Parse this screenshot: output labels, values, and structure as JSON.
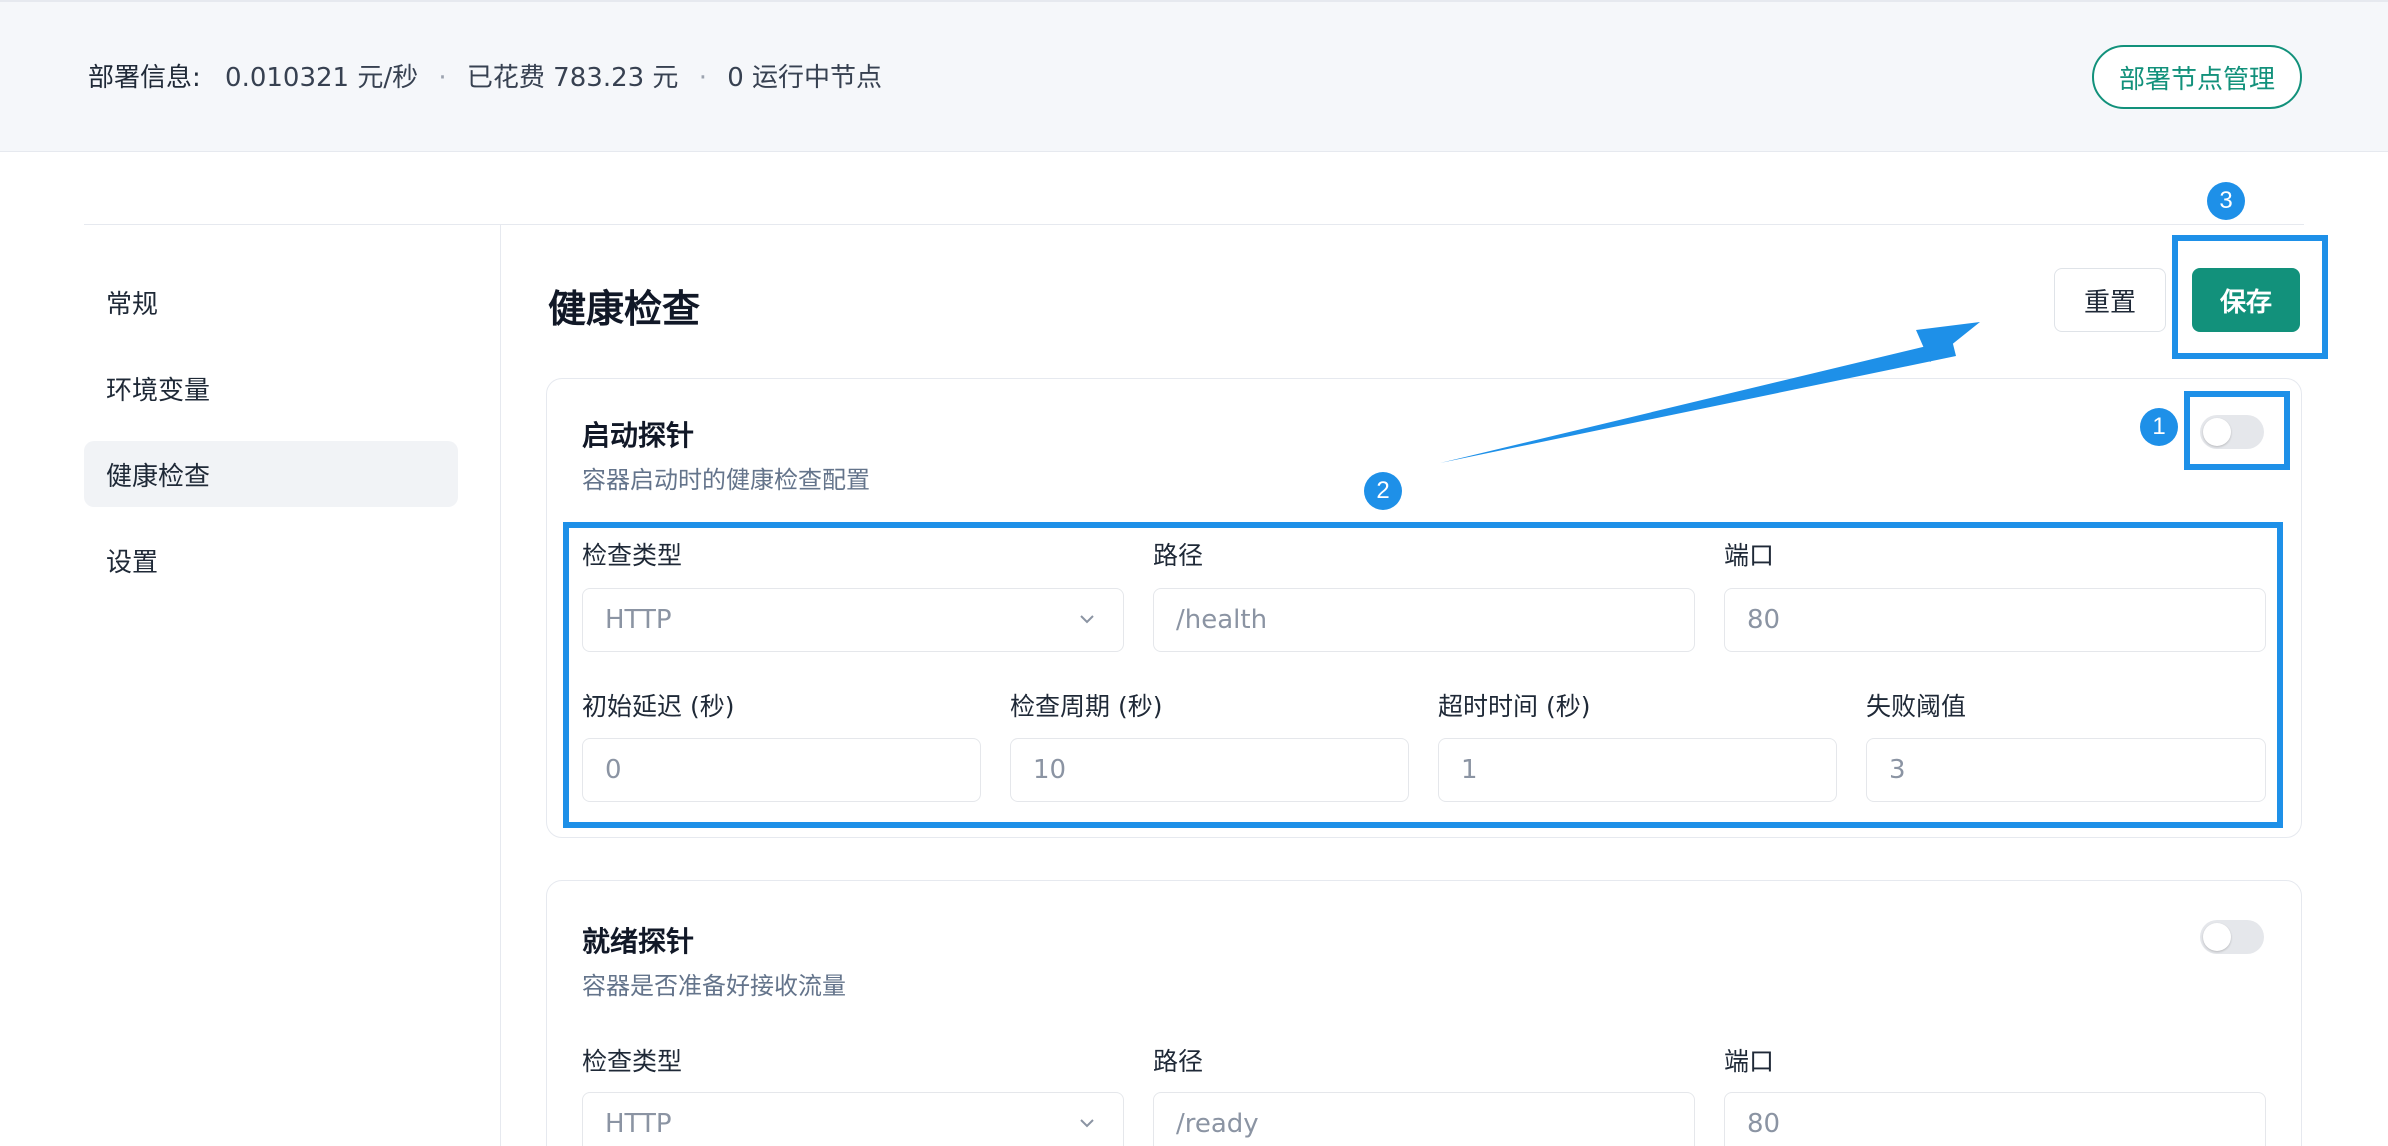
{
  "topbar": {
    "label": "部署信息:",
    "rate": "0.010321 元/秒",
    "spent": "已花费 783.23 元",
    "nodes": "0 运行中节点",
    "separator": "·",
    "manage_button": "部署节点管理"
  },
  "sidebar": {
    "items": [
      {
        "label": "常规",
        "active": false
      },
      {
        "label": "环境变量",
        "active": false
      },
      {
        "label": "健康检查",
        "active": true
      },
      {
        "label": "设置",
        "active": false
      }
    ]
  },
  "header": {
    "title": "健康检查",
    "reset_label": "重置",
    "save_label": "保存"
  },
  "startup_probe": {
    "title": "启动探针",
    "description": "容器启动时的健康检查配置",
    "enabled": false,
    "check_type_label": "检查类型",
    "check_type_value": "HTTP",
    "path_label": "路径",
    "path_value": "/health",
    "port_label": "端口",
    "port_value": "80",
    "initial_delay_label": "初始延迟 (秒)",
    "initial_delay_value": "0",
    "period_label": "检查周期 (秒)",
    "period_value": "10",
    "timeout_label": "超时时间 (秒)",
    "timeout_value": "1",
    "failure_label": "失败阈值",
    "failure_value": "3"
  },
  "readiness_probe": {
    "title": "就绪探针",
    "description": "容器是否准备好接收流量",
    "enabled": false,
    "check_type_label": "检查类型",
    "check_type_value": "HTTP",
    "path_label": "路径",
    "path_value": "/ready",
    "port_label": "端口",
    "port_value": "80"
  },
  "annotations": {
    "badge_1": "1",
    "badge_2": "2",
    "badge_3": "3"
  },
  "colors": {
    "accent": "#12917b",
    "annotation": "#1e90e8",
    "muted_text": "#64748b"
  }
}
